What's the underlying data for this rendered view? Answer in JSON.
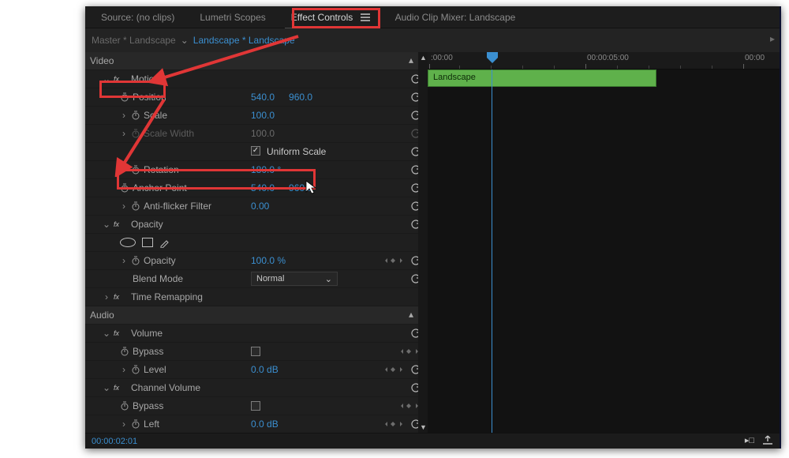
{
  "topbar": {
    "tabs": [
      {
        "label": "Source: (no clips)"
      },
      {
        "label": "Lumetri Scopes"
      },
      {
        "label": "Effect Controls"
      },
      {
        "label": "Audio Clip Mixer: Landscape"
      }
    ],
    "active_index": 2
  },
  "masterbar": {
    "master_label": "Master * Landscape",
    "clip_label": "Landscape * Landscape"
  },
  "sections": {
    "video_label": "Video",
    "audio_label": "Audio"
  },
  "motion": {
    "group_label": "Motion",
    "position_label": "Position",
    "position_x": "540.0",
    "position_y": "960.0",
    "scale_label": "Scale",
    "scale_value": "100.0",
    "scale_width_label": "Scale Width",
    "scale_width_value": "100.0",
    "uniform_label": "Uniform Scale",
    "rotation_label": "Rotation",
    "rotation_value": "180.0 °",
    "anchor_label": "Anchor Point",
    "anchor_x": "540.0",
    "anchor_y": "960.0",
    "antiflicker_label": "Anti-flicker Filter",
    "antiflicker_value": "0.00"
  },
  "opacity": {
    "group_label": "Opacity",
    "opacity_label": "Opacity",
    "opacity_value": "100.0 %",
    "blend_label": "Blend Mode",
    "blend_value": "Normal"
  },
  "time_remap": {
    "label": "Time Remapping"
  },
  "volume": {
    "group_label": "Volume",
    "bypass_label": "Bypass",
    "level_label": "Level",
    "level_value": "0.0 dB"
  },
  "channel_volume": {
    "group_label": "Channel Volume",
    "bypass_label": "Bypass",
    "left_label": "Left",
    "left_value": "0.0 dB"
  },
  "timeline": {
    "ticks": [
      ":00:00",
      "00:00:05:00",
      "00:00"
    ],
    "clip_name": "Landscape"
  },
  "bottom": {
    "timecode": "00:00:02:01"
  },
  "colors": {
    "accent_blue": "#3b8fd0",
    "clip_green": "#5fb14b",
    "highlight_red": "#e03636"
  }
}
